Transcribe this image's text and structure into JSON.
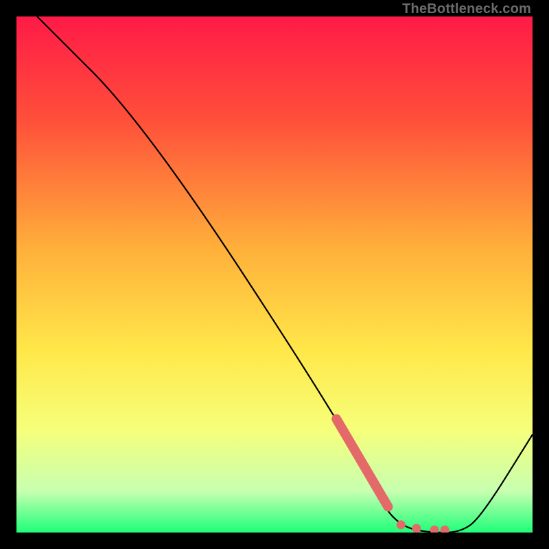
{
  "watermark": "TheBottleneck.com",
  "chart_data": {
    "type": "line",
    "title": "",
    "xlabel": "",
    "ylabel": "",
    "xlim": [
      0,
      100
    ],
    "ylim": [
      0,
      100
    ],
    "gradient_stops": [
      {
        "offset": 0,
        "color": "#ff1a47"
      },
      {
        "offset": 20,
        "color": "#ff4f3a"
      },
      {
        "offset": 45,
        "color": "#ffb03a"
      },
      {
        "offset": 65,
        "color": "#ffe84a"
      },
      {
        "offset": 80,
        "color": "#f6ff7a"
      },
      {
        "offset": 92,
        "color": "#c7ffb0"
      },
      {
        "offset": 100,
        "color": "#1fff79"
      }
    ],
    "series": [
      {
        "name": "bottleneck-curve",
        "points": [
          {
            "x": 4,
            "y": 100
          },
          {
            "x": 25,
            "y": 79
          },
          {
            "x": 63,
            "y": 21
          },
          {
            "x": 71,
            "y": 5
          },
          {
            "x": 75,
            "y": 1
          },
          {
            "x": 80,
            "y": 0
          },
          {
            "x": 86,
            "y": 0
          },
          {
            "x": 90,
            "y": 3
          },
          {
            "x": 100,
            "y": 19
          }
        ]
      }
    ],
    "markers": {
      "name": "highlight-band",
      "color": "#e46a6a",
      "thick_segment": {
        "x1": 62,
        "y1": 22,
        "x2": 72,
        "y2": 5
      },
      "dots": [
        {
          "x": 74.5,
          "y": 1.5
        },
        {
          "x": 77.5,
          "y": 0.8
        },
        {
          "x": 81,
          "y": 0.5
        },
        {
          "x": 83,
          "y": 0.5
        }
      ]
    }
  }
}
